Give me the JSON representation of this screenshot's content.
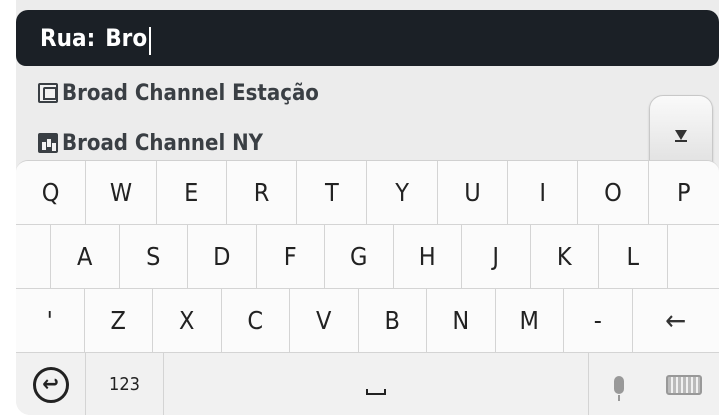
{
  "search": {
    "label": "Rua:",
    "value": "Bro"
  },
  "results": [
    {
      "icon": "train-station-icon",
      "text": "Broad Channel Estação"
    },
    {
      "icon": "city-icon",
      "text": "Broad Channel NY"
    }
  ],
  "scroll": {
    "icon": "scroll-down-icon"
  },
  "keyboard": {
    "row1": [
      "Q",
      "W",
      "E",
      "R",
      "T",
      "Y",
      "U",
      "I",
      "O",
      "P"
    ],
    "row2": [
      "A",
      "S",
      "D",
      "F",
      "G",
      "H",
      "J",
      "K",
      "L"
    ],
    "row3": [
      "'",
      "Z",
      "X",
      "C",
      "V",
      "B",
      "N",
      "M",
      "-"
    ],
    "backspace_glyph": "←",
    "back_glyph": "↩",
    "numbers_label": "123",
    "space_icon": "space-icon",
    "mic_icon": "microphone-icon",
    "keyboard_icon": "keyboard-layout-icon"
  }
}
